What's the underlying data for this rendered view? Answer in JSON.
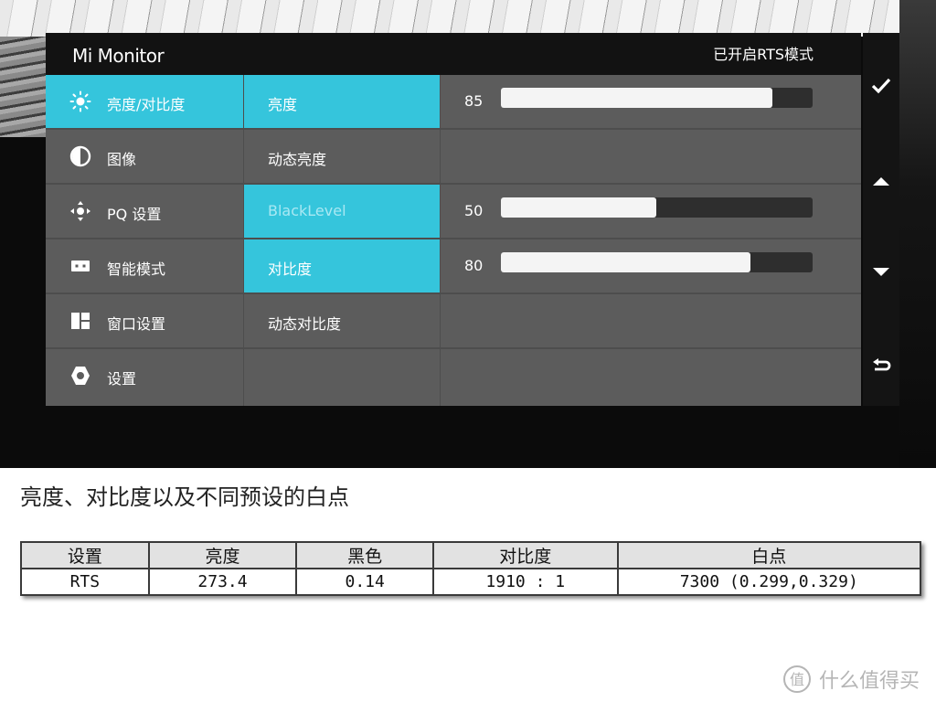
{
  "osd": {
    "app_title": "Mi Monitor",
    "mode_status": "已开启RTS模式",
    "menu": [
      {
        "label": "亮度/对比度",
        "icon": "brightness-icon",
        "active": true
      },
      {
        "label": "图像",
        "icon": "contrast-circle-icon",
        "active": false
      },
      {
        "label": "PQ 设置",
        "icon": "move-arrows-icon",
        "active": false
      },
      {
        "label": "智能模式",
        "icon": "smart-mode-icon",
        "active": false
      },
      {
        "label": "窗口设置",
        "icon": "window-layout-icon",
        "active": false
      },
      {
        "label": "设置",
        "icon": "settings-gear-icon",
        "active": false
      }
    ],
    "submenu": [
      {
        "label": "亮度",
        "active": true
      },
      {
        "label": "动态亮度",
        "active": false
      },
      {
        "label": "BlackLevel",
        "active": true
      },
      {
        "label": "对比度",
        "active": true
      },
      {
        "label": "动态对比度",
        "active": false
      },
      {
        "label": "",
        "active": false
      }
    ],
    "values": {
      "brightness": {
        "value": "85",
        "level": 0.85
      },
      "black_level": {
        "value": "50",
        "level": 0.5
      },
      "contrast": {
        "value": "80",
        "level": 0.8
      }
    },
    "side_icons": [
      "checkmark-icon",
      "up-arrow-icon",
      "down-arrow-icon",
      "back-icon"
    ],
    "accent_color": "#35c5dc"
  },
  "caption": "亮度、对比度以及不同预设的白点",
  "table": {
    "headers": [
      "设置",
      "亮度",
      "黑色",
      "对比度",
      "白点"
    ],
    "rows": [
      [
        "RTS",
        "273.4",
        "0.14",
        "1910 : 1",
        "7300 (0.299,0.329)"
      ]
    ]
  },
  "watermark": {
    "text": "什么值得买",
    "icon": "zhi-logo-icon"
  }
}
